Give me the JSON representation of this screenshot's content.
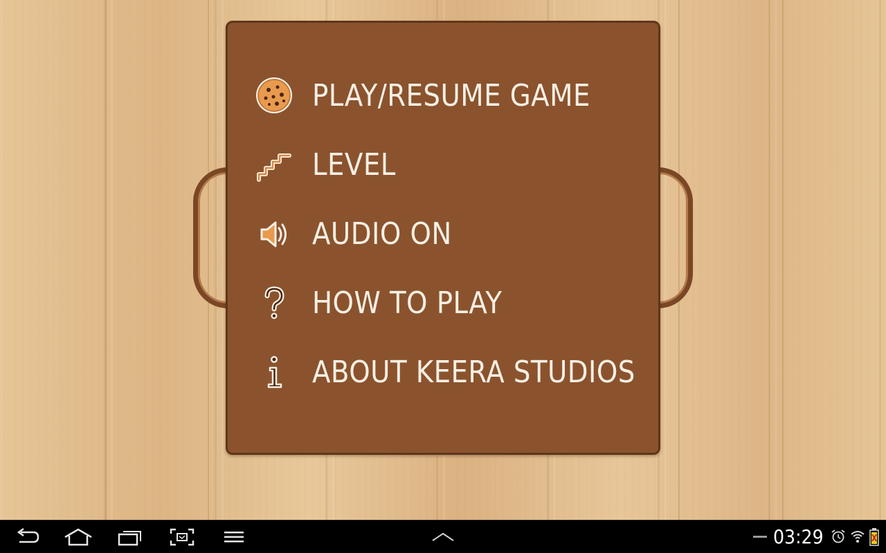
{
  "menu": {
    "items": [
      {
        "label": "PLAY/RESUME GAME",
        "icon": "cookie-icon"
      },
      {
        "label": "LEVEL",
        "icon": "stairs-icon"
      },
      {
        "label": "AUDIO ON",
        "icon": "speaker-icon"
      },
      {
        "label": "HOW TO PLAY",
        "icon": "question-mark-icon"
      },
      {
        "label": "ABOUT KEERA STUDIOS",
        "icon": "info-icon"
      }
    ]
  },
  "status_bar": {
    "time": "03:29",
    "icons": [
      "alarm-icon",
      "wifi-icon",
      "battery-icon"
    ]
  },
  "nav_bar": {
    "buttons": [
      "back-icon",
      "home-icon",
      "recent-apps-icon",
      "screenshot-icon",
      "menu-icon"
    ],
    "center": "chevron-up-icon"
  },
  "colors": {
    "board": "#8a532e",
    "board_border": "#5f3619",
    "label": "#f7efe4",
    "wood": "#e2bd8c",
    "navbar": "#000000"
  }
}
